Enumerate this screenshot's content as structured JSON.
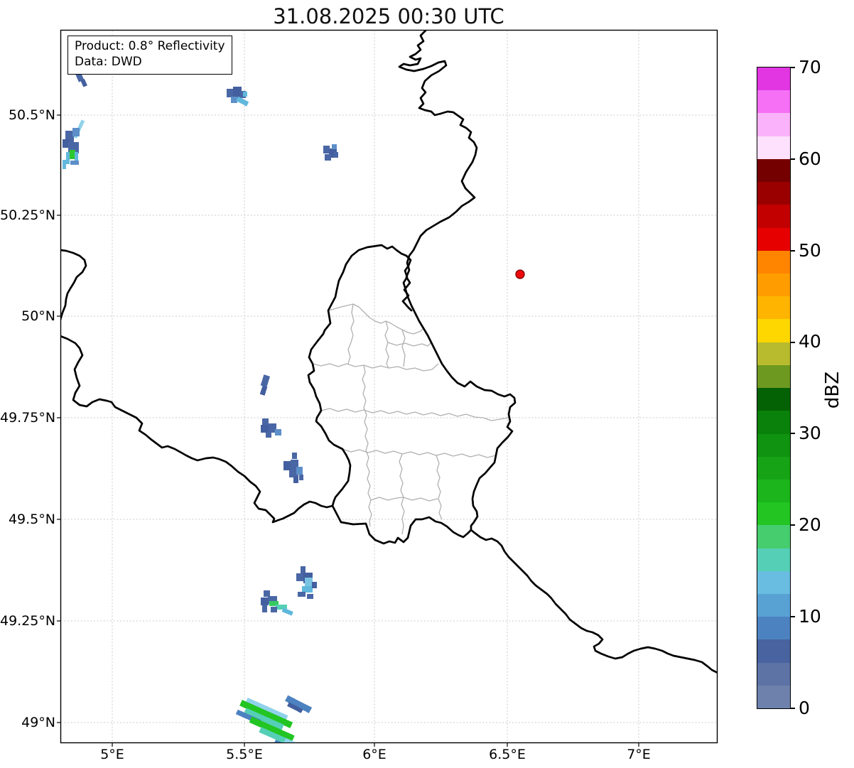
{
  "title": "31.08.2025 00:30 UTC",
  "info_box": {
    "product": "Product: 0.8° Reflectivity",
    "source": "Data: DWD"
  },
  "axes": {
    "lat": [
      "50.5°N",
      "50.25°N",
      "50°N",
      "49.75°N",
      "49.5°N",
      "49.25°N",
      "49°N"
    ],
    "lon": [
      "5°E",
      "5.5°E",
      "6°E",
      "6.5°E",
      "7°E"
    ]
  },
  "colorbar": {
    "label": "dBZ",
    "ticks": [
      "70",
      "60",
      "50",
      "40",
      "30",
      "20",
      "10",
      "0"
    ],
    "min": 0,
    "max": 70,
    "step_dbz": 2.5,
    "colors_bottom_to_top": [
      "#6e81ac",
      "#5d73a6",
      "#48639f",
      "#4d82c0",
      "#58a1d3",
      "#69bde1",
      "#55cfb6",
      "#46cd6e",
      "#22c522",
      "#1cb51c",
      "#16a416",
      "#109310",
      "#0a810a",
      "#046104",
      "#6e9920",
      "#b9bb2e",
      "#ffd700",
      "#ffb500",
      "#ff9d00",
      "#ff8400",
      "#e60000",
      "#c30000",
      "#9b0000",
      "#740000",
      "#fde1fd",
      "#fab2fa",
      "#f570f5",
      "#e136e1"
    ]
  },
  "marker": {
    "description": "radar site marker",
    "color": "#ee0a0a"
  }
}
